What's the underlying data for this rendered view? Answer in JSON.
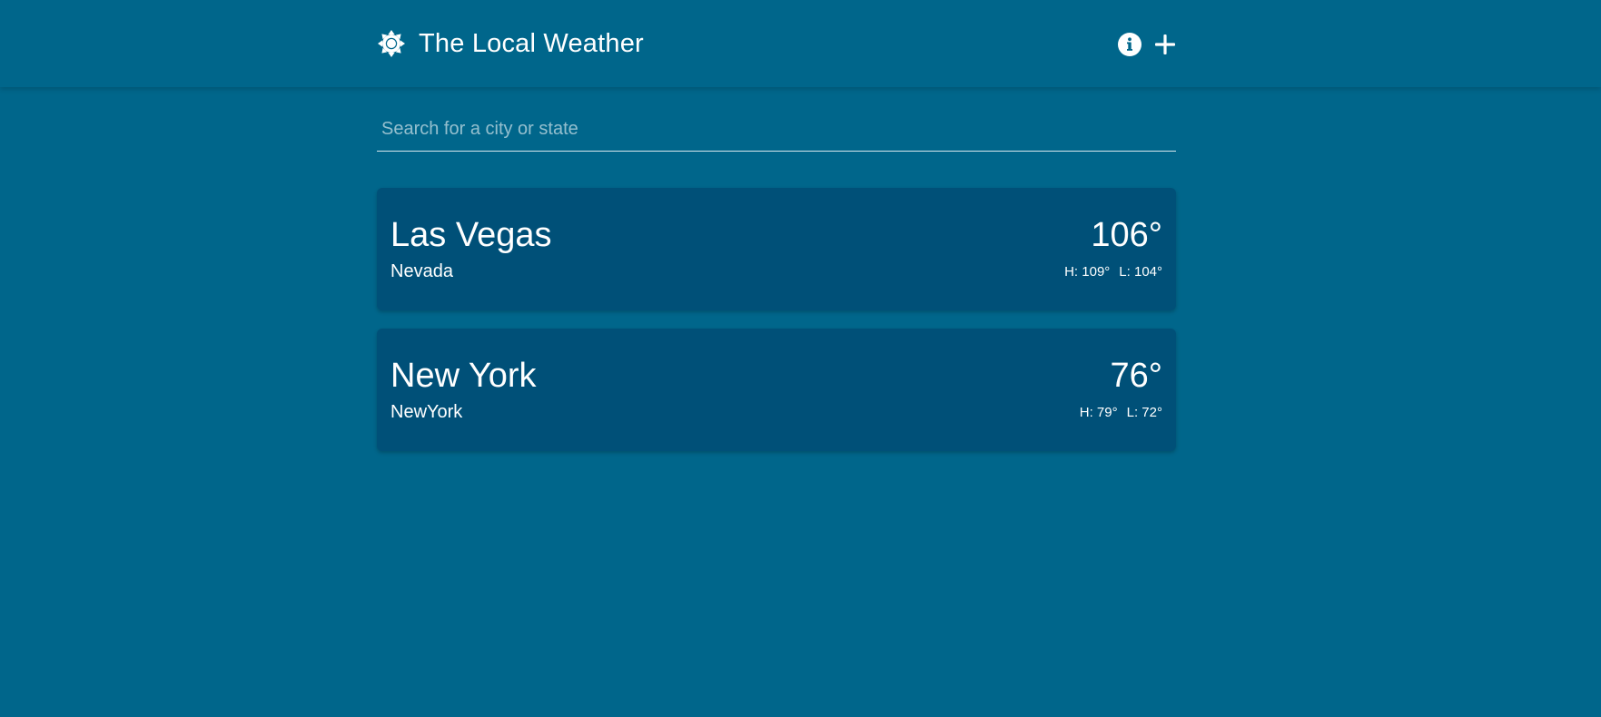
{
  "header": {
    "title": "The Local Weather",
    "logo_icon": "sun-icon",
    "actions": [
      {
        "name": "info",
        "icon": "info-circle-icon"
      },
      {
        "name": "add",
        "icon": "plus-icon"
      }
    ]
  },
  "search": {
    "placeholder": "Search for a city or state",
    "value": ""
  },
  "cities": [
    {
      "city": "Las Vegas",
      "state": "Nevada",
      "temp": "106°",
      "high": "H: 109°",
      "low": "L: 104°"
    },
    {
      "city": "New York",
      "state": "NewYork",
      "temp": "76°",
      "high": "H: 79°",
      "low": "L: 72°"
    }
  ],
  "colors": {
    "background": "#00668b",
    "card": "#005078",
    "text": "#ffffff"
  }
}
